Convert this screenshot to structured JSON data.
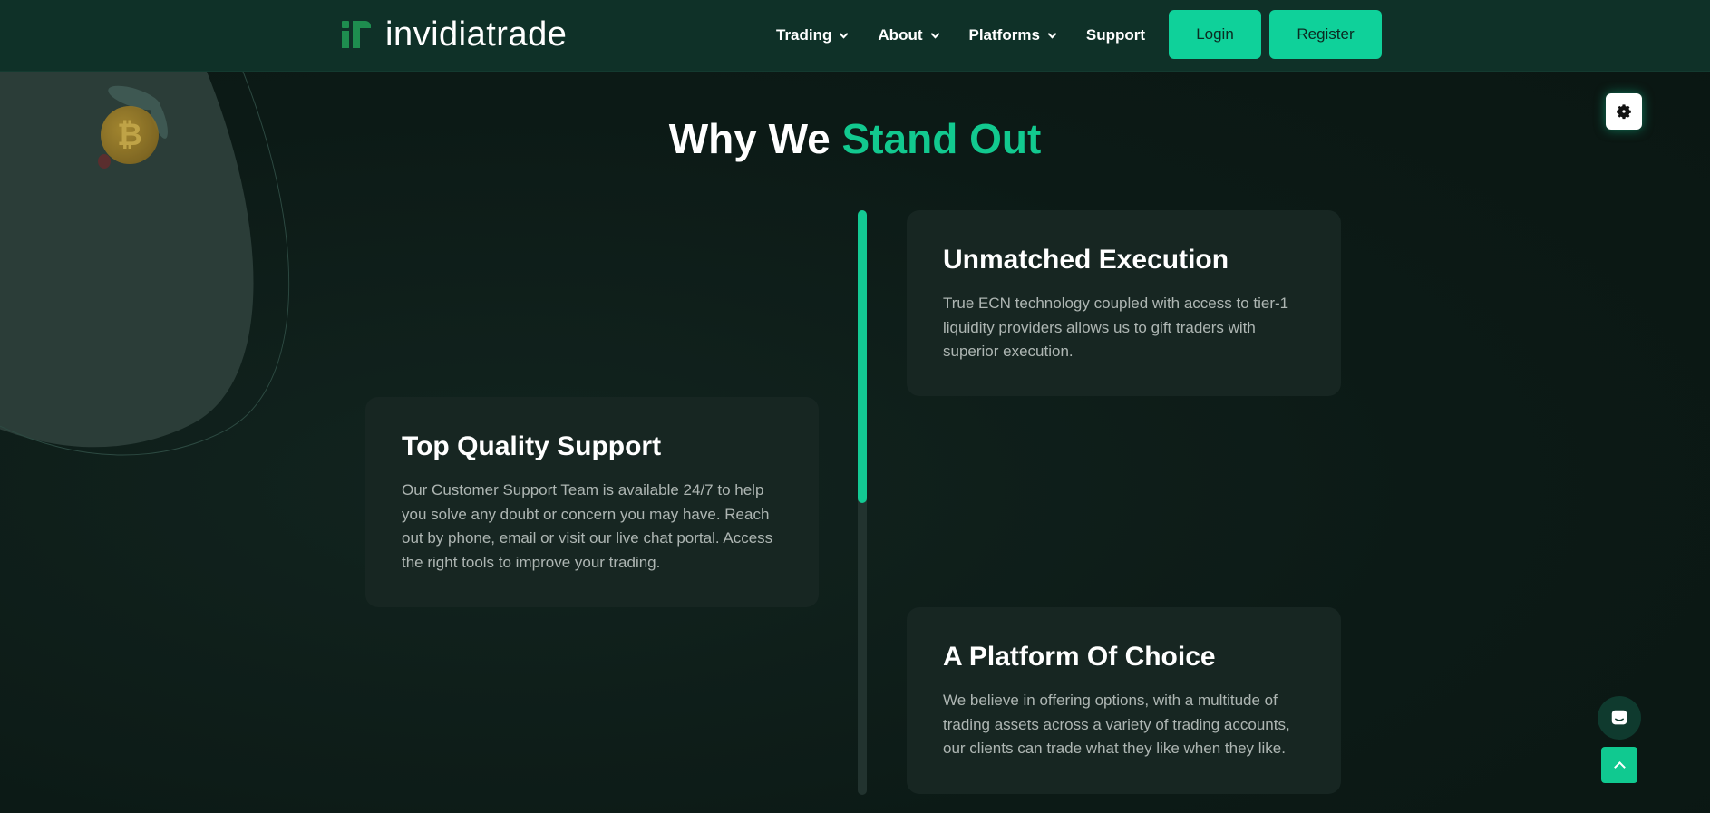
{
  "header": {
    "logo_text": "invidiatrade",
    "nav": [
      {
        "label": "Trading",
        "has_dropdown": true
      },
      {
        "label": "About",
        "has_dropdown": true
      },
      {
        "label": "Platforms",
        "has_dropdown": true
      },
      {
        "label": "Support",
        "has_dropdown": false
      }
    ],
    "login_label": "Login",
    "register_label": "Register"
  },
  "section": {
    "title_prefix": "Why We ",
    "title_accent": "Stand Out",
    "cards": [
      {
        "title": "Unmatched Execution",
        "text": "True ECN technology coupled with access to tier-1 liquidity providers allows us to gift traders with superior execution."
      },
      {
        "title": "Top Quality Support",
        "text": "Our Customer Support Team is available 24/7 to help you solve any doubt or concern you may have. Reach out by phone, email or visit our live chat portal. Access the right tools to improve your trading."
      },
      {
        "title": "A Platform Of Choice",
        "text": "We believe in offering options, with a multitude of trading assets across a variety of trading accounts, our clients can trade what they like when they like."
      }
    ],
    "timeline_progress": 0.5
  },
  "icons": {
    "settings": "gear-icon",
    "chat": "chat-icon",
    "back_to_top": "chevron-up-icon",
    "decoration": "bitcoin-coin-icon"
  },
  "colors": {
    "accent": "#13c993",
    "header_bg": "#0f3128",
    "page_bg": "#0d1b17",
    "card_bg": "#172622"
  }
}
